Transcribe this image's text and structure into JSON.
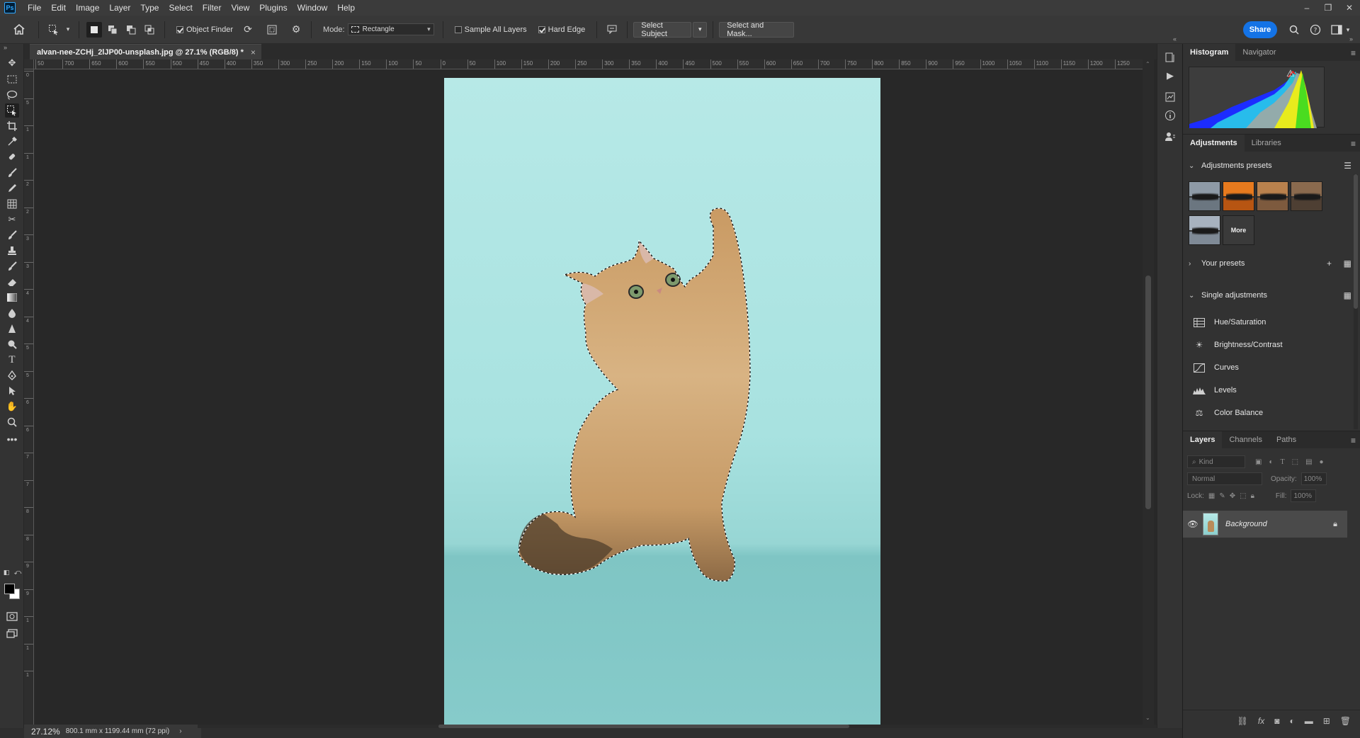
{
  "app": {
    "logo": "Ps"
  },
  "menu": [
    "File",
    "Edit",
    "Image",
    "Layer",
    "Type",
    "Select",
    "Filter",
    "View",
    "Plugins",
    "Window",
    "Help"
  ],
  "window_controls": {
    "minimize": "–",
    "restore": "❐",
    "close": "✕"
  },
  "options": {
    "object_finder": "Object Finder",
    "mode_label": "Mode:",
    "mode_value": "Rectangle",
    "sample_all_layers": "Sample All Layers",
    "hard_edge": "Hard Edge",
    "select_subject": "Select Subject",
    "select_and_mask": "Select and Mask...",
    "share": "Share"
  },
  "document": {
    "tab_title": "alvan-nee-ZCHj_2lJP00-unsplash.jpg @ 27.1% (RGB/8) *",
    "close": "×"
  },
  "ruler_h": [
    "50",
    "700",
    "650",
    "600",
    "550",
    "500",
    "450",
    "400",
    "350",
    "300",
    "250",
    "200",
    "150",
    "100",
    "50",
    "0",
    "50",
    "100",
    "150",
    "200",
    "250",
    "300",
    "350",
    "400",
    "450",
    "500",
    "550",
    "600",
    "650",
    "700",
    "750",
    "800",
    "850",
    "900",
    "950",
    "1000",
    "1050",
    "1100",
    "1150",
    "1200",
    "1250"
  ],
  "ruler_v": [
    "0",
    "5",
    "1",
    "1",
    "2",
    "2",
    "3",
    "3",
    "4",
    "4",
    "5",
    "5",
    "6",
    "6",
    "7",
    "7",
    "8",
    "8",
    "9",
    "9",
    "1",
    "1",
    "1"
  ],
  "status": {
    "zoom": "27.12%",
    "doc_size": "800.1 mm x 1199.44 mm (72 ppi)",
    "arrow": "›"
  },
  "histogram": {
    "tabs": [
      "Histogram",
      "Navigator"
    ],
    "warning": "⚠"
  },
  "adjustments": {
    "tabs": [
      "Adjustments",
      "Libraries"
    ],
    "presets_title": "Adjustments presets",
    "more": "More",
    "your_presets": "Your presets",
    "single_adjustments": "Single adjustments",
    "items": [
      "Hue/Saturation",
      "Brightness/Contrast",
      "Curves",
      "Levels",
      "Color Balance"
    ]
  },
  "layers": {
    "tabs": [
      "Layers",
      "Channels",
      "Paths"
    ],
    "kind_placeholder": "Kind",
    "blend_mode": "Normal",
    "opacity_label": "Opacity:",
    "opacity_value": "100%",
    "lock_label": "Lock:",
    "fill_label": "Fill:",
    "fill_value": "100%",
    "layer_name": "Background"
  },
  "colors": {
    "accent": "#1473e6",
    "canvas_bg": "#282828",
    "panel_bg": "#323232",
    "photo_bg": "#b7e9e7"
  }
}
